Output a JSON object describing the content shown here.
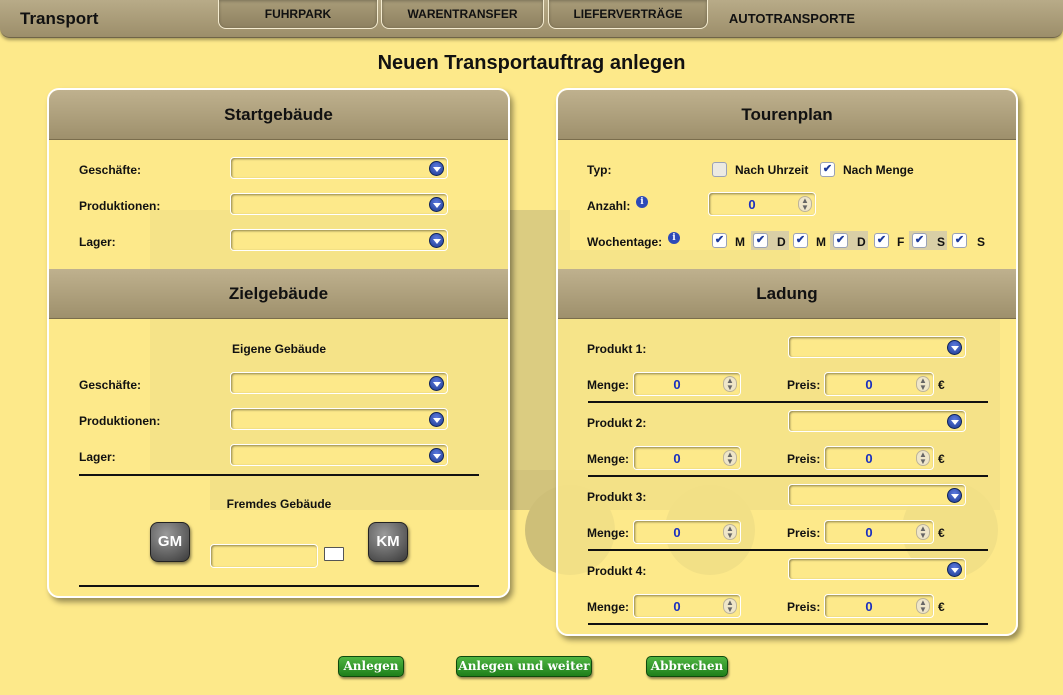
{
  "app": {
    "title": "Transport"
  },
  "tabs": [
    {
      "label": "FUHRPARK"
    },
    {
      "label": "WARENTRANSFER"
    },
    {
      "label": "LIEFERVERTRÄGE"
    },
    {
      "label": "AUTOTRANSPORTE"
    }
  ],
  "page": {
    "title": "Neuen Transportauftrag anlegen"
  },
  "start": {
    "heading": "Startgebäude",
    "shops_label": "Geschäfte:",
    "productions_label": "Produktionen:",
    "storage_label": "Lager:"
  },
  "target": {
    "heading": "Zielgebäude",
    "own_label": "Eigene Gebäude",
    "shops_label": "Geschäfte:",
    "productions_label": "Produktionen:",
    "storage_label": "Lager:",
    "foreign_label": "Fremdes Gebäude",
    "gm_label": "GM",
    "km_label": "KM"
  },
  "tour": {
    "heading": "Tourenplan",
    "type_label": "Typ:",
    "opt_time": "Nach Uhrzeit",
    "opt_amount": "Nach Menge",
    "opt_time_checked": false,
    "opt_amount_checked": true,
    "count_label": "Anzahl:",
    "count_value": "0",
    "weekdays_label": "Wochentage:",
    "days": [
      {
        "label": "M",
        "checked": true
      },
      {
        "label": "D",
        "checked": true
      },
      {
        "label": "M",
        "checked": true
      },
      {
        "label": "D",
        "checked": true
      },
      {
        "label": "F",
        "checked": true
      },
      {
        "label": "S",
        "checked": true
      },
      {
        "label": "S",
        "checked": true
      }
    ]
  },
  "load": {
    "heading": "Ladung",
    "menge_label": "Menge:",
    "preis_label": "Preis:",
    "currency": "€",
    "products": [
      {
        "label": "Produkt 1:",
        "menge": "0",
        "preis": "0"
      },
      {
        "label": "Produkt 2:",
        "menge": "0",
        "preis": "0"
      },
      {
        "label": "Produkt 3:",
        "menge": "0",
        "preis": "0"
      },
      {
        "label": "Produkt 4:",
        "menge": "0",
        "preis": "0"
      }
    ]
  },
  "buttons": {
    "create": "Anlegen",
    "create_next": "Anlegen und weiter",
    "cancel": "Abbrechen"
  },
  "icons": {
    "dropdown": "chevron-down-icon",
    "info": "info-icon",
    "book": "book-icon"
  },
  "colors": {
    "background": "#fde98a",
    "header": "#a89b76",
    "button": "#2d9a25",
    "value": "#1a2fbf"
  }
}
